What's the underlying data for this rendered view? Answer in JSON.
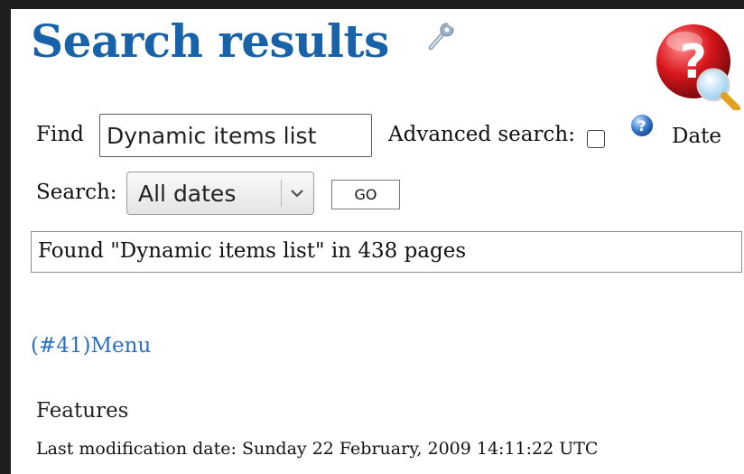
{
  "page": {
    "title": "Search results",
    "colors": {
      "title": "#1762a8",
      "link": "#2a6fc4"
    }
  },
  "form": {
    "find_label": "Find",
    "find_value": "Dynamic items list",
    "advanced_label": "Advanced search:",
    "advanced_checked": false,
    "date_label": "Date",
    "search_label": "Search:",
    "search_selected": "All dates",
    "go_label": "GO"
  },
  "summary": "Found \"Dynamic items list\" in 438 pages",
  "results": [
    {
      "link": "(#41)Menu",
      "section": "Features",
      "modified": "Last modification date: Sunday 22 February, 2009 14:11:22 UTC"
    }
  ],
  "icons": [
    "wrench-icon",
    "help-search-icon",
    "info-icon",
    "chevron-down-icon"
  ]
}
